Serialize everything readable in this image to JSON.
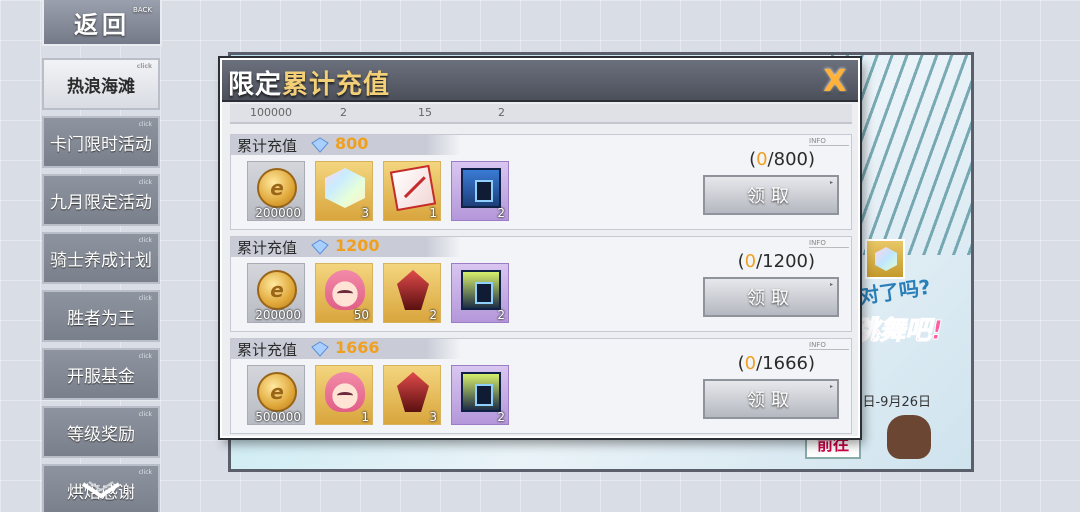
{
  "nav": {
    "back_label": "返回",
    "back_sub": "BACK",
    "items": [
      {
        "label": "热浪海滩",
        "active": true
      },
      {
        "label": "卡门限时活动",
        "active": false
      },
      {
        "label": "九月限定活动",
        "active": false
      },
      {
        "label": "骑士养成计划",
        "active": false
      },
      {
        "label": "胜者为王",
        "active": false
      },
      {
        "label": "开服基金",
        "active": false
      },
      {
        "label": "等级奖励",
        "active": false
      },
      {
        "label": "烘焙感谢",
        "active": false
      }
    ],
    "tag": "click"
  },
  "background": {
    "text_a": "派对了吗?",
    "text_b": "跳舞吧!",
    "date": "日-9月26日",
    "goto_label": "前往"
  },
  "dialog": {
    "title_prefix": "限定",
    "title_main": "累计充值",
    "close_label": "X",
    "prev_values": [
      "100000",
      "2",
      "15",
      "2"
    ],
    "tiers": [
      {
        "label": "累计充值",
        "amount": "800",
        "progress_current": "0",
        "progress_target": "/800",
        "claim_label": "领取",
        "info": "INFO",
        "rewards": [
          {
            "icon": "gold-coin-icon",
            "qty": "200000"
          },
          {
            "icon": "prism-crystal-icon",
            "qty": "3"
          },
          {
            "icon": "red-card-icon",
            "qty": "1"
          },
          {
            "icon": "mystery-box-icon",
            "qty": "2"
          }
        ]
      },
      {
        "label": "累计充值",
        "amount": "1200",
        "progress_current": "0",
        "progress_target": "/1200",
        "claim_label": "领取",
        "info": "INFO",
        "rewards": [
          {
            "icon": "gold-coin-icon",
            "qty": "200000"
          },
          {
            "icon": "character-portrait-icon",
            "qty": "50"
          },
          {
            "icon": "red-crystal-icon",
            "qty": "2"
          },
          {
            "icon": "mystery-box-icon",
            "qty": "2"
          }
        ]
      },
      {
        "label": "累计充值",
        "amount": "1666",
        "progress_current": "0",
        "progress_target": "/1666",
        "claim_label": "领取",
        "info": "INFO",
        "rewards": [
          {
            "icon": "gold-coin-icon",
            "qty": "500000"
          },
          {
            "icon": "character-portrait-icon",
            "qty": "1"
          },
          {
            "icon": "red-crystal-icon",
            "qty": "3"
          },
          {
            "icon": "mystery-box-icon",
            "qty": "2"
          }
        ]
      }
    ]
  },
  "colors": {
    "accent_gold": "#f0a020",
    "title_gold": "#f3d078",
    "close_orange": "#ffb23a"
  }
}
